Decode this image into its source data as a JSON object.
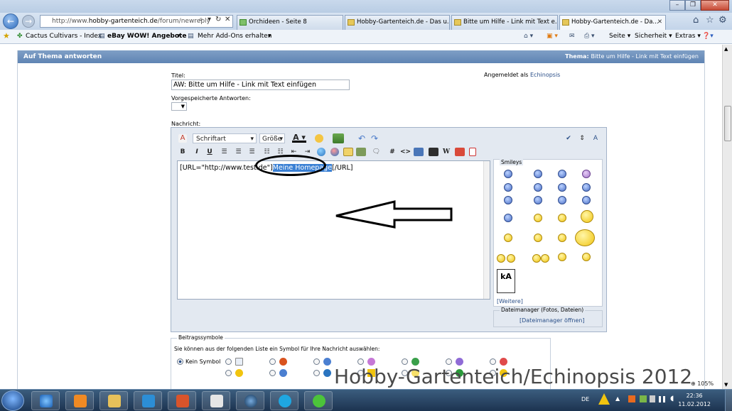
{
  "browser": {
    "address": "http://www.hobby-gartenteich.de/forum/newreply",
    "address_prefix": "http://www.",
    "address_domain": "hobby-gartenteich.de",
    "address_suffix": "/forum/newreply",
    "tabs": [
      {
        "label": "Orchideen - Seite 8"
      },
      {
        "label": "Hobby-Gartenteich.de - Das u..."
      },
      {
        "label": "Bitte um Hilfe - Link mit Text e..."
      },
      {
        "label": "Hobby-Gartenteich.de - Da..."
      }
    ],
    "favorites": [
      {
        "label": "Cactus Cultivars - Index"
      },
      {
        "label": "eBay WOW! Angebote"
      },
      {
        "label": "Mehr Add-Ons erhalten"
      }
    ],
    "tools": {
      "page": "Seite",
      "security": "Sicherheit",
      "extras": "Extras"
    }
  },
  "forum": {
    "header_title": "Auf Thema antworten",
    "thema_label": "Thema:",
    "thema_value": "Bitte um Hilfe - Link mit Text einfügen",
    "title_label": "Titel:",
    "title_value": "AW: Bitte um Hilfe - Link mit Text einfügen",
    "logged_in_label": "Angemeldet als",
    "logged_in_user": "Echinopsis",
    "saved_answers_label": "Vorgespeicherte Antworten:",
    "message_label": "Nachricht:",
    "font_label": "Schriftart",
    "size_label": "Größe",
    "editor_text_before": "[URL=\"http://www.test.de\"]",
    "editor_text_selected": "Meine Homepage",
    "editor_text_after": "[/URL]",
    "smileys_title": "Smileys",
    "more_link": "[Weitere]",
    "filemanager_title": "Dateimanager (Fotos, Dateien)",
    "filemanager_link": "[Dateimanager öffnen]",
    "post_icons_title": "Beitragssymbole",
    "post_icons_desc": "Sie können aus der folgenden Liste ein Symbol für Ihre Nachricht auswählen:",
    "no_icon_label": "Kein Symbol"
  },
  "taskbar": {
    "lang": "DE",
    "time": "22:36",
    "date": "11.02.2012",
    "zoom": "105%"
  },
  "watermark": "Hobby-Gartenteich/Echinopsis 2012"
}
